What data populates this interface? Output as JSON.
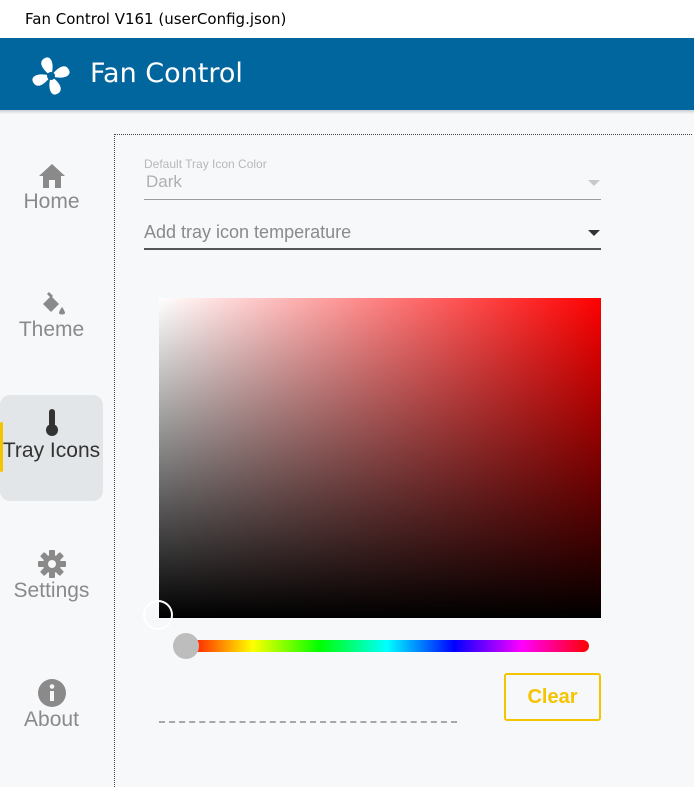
{
  "window": {
    "title": "Fan Control V161 (userConfig.json)"
  },
  "app": {
    "title": "Fan Control",
    "logo_icon": "fan-icon"
  },
  "sidebar": {
    "items": [
      {
        "label": "Home",
        "icon": "home-icon",
        "active": false
      },
      {
        "label": "Theme",
        "icon": "paint-bucket-icon",
        "active": false
      },
      {
        "label": "Tray Icons",
        "icon": "thermometer-icon",
        "active": true
      },
      {
        "label": "Settings",
        "icon": "gear-icon",
        "active": false
      },
      {
        "label": "About",
        "icon": "info-icon",
        "active": false
      }
    ]
  },
  "content": {
    "default_tray_color": {
      "label": "Default Tray Icon Color",
      "value": "Dark"
    },
    "add_temperature": {
      "placeholder": "Add tray icon temperature"
    },
    "color_picker": {
      "hue_color": "#ff0000"
    },
    "clear_button": {
      "label": "Clear",
      "color": "#f5c400"
    }
  },
  "colors": {
    "appbar": "#01669e",
    "accent": "#f5c400"
  }
}
